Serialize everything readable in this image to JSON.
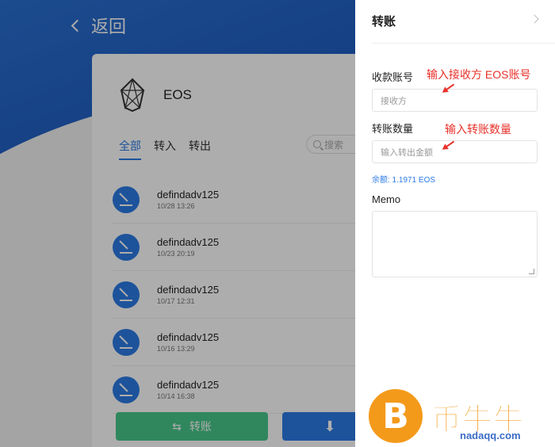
{
  "back": {
    "label": "返回"
  },
  "wallet": {
    "token": "EOS"
  },
  "tabs": [
    "全部",
    "转入",
    "转出"
  ],
  "search": {
    "placeholder": "搜索"
  },
  "transactions": [
    {
      "name": "defindadv125",
      "time": "10/28 13:26"
    },
    {
      "name": "defindadv125",
      "time": "10/23 20:19"
    },
    {
      "name": "defindadv125",
      "time": "10/17 12:31"
    },
    {
      "name": "defindadv125",
      "time": "10/16 13:29"
    },
    {
      "name": "defindadv125",
      "time": "10/14 16:38"
    }
  ],
  "actions": {
    "transfer_label": "转账"
  },
  "drawer": {
    "title": "转账",
    "recipient_label": "收款账号",
    "recipient_placeholder": "接收方",
    "amount_label": "转账数量",
    "amount_placeholder": "输入转出金额",
    "balance": "余额: 1.1971 EOS",
    "memo_label": "Memo"
  },
  "annotations": {
    "recipient_hint": "输入接收方 EOS账号",
    "amount_hint": "输入转账数量"
  },
  "watermark": {
    "coin": "B",
    "text": "币牛牛",
    "site": "nadaqq.com"
  },
  "colors": {
    "primary": "#2c7be5",
    "transfer": "#48c88a",
    "annotation": "#e8302a",
    "watermark": "#f39a1b"
  }
}
